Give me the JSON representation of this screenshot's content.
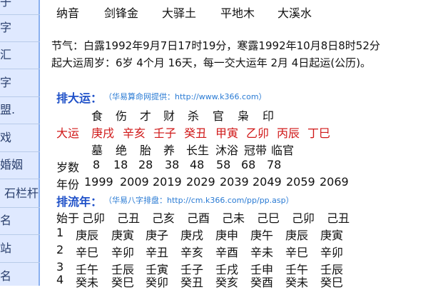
{
  "sidebar": {
    "items": [
      "子",
      "字",
      "汇",
      "字",
      "盟.",
      "戏",
      "婚姻",
      "石栏杆",
      "名",
      "站",
      "名"
    ]
  },
  "nayin": {
    "label": "纳音",
    "values": [
      "剑锋金",
      "大驿土",
      "平地木",
      "大溪水"
    ]
  },
  "jieqi": {
    "line1": "节气：白露1992年9月7日17时19分，寒露1992年10月8日8时52分",
    "line2": "起大运周岁：6岁 4个月 16天，每一交大运年 2月 4日起运(公历)。"
  },
  "dayun": {
    "title": "排大运：",
    "note": "（华易算命网提供：http://www.k366.com）",
    "shishen": [
      "食",
      "伤",
      "才",
      "财",
      "杀",
      "官",
      "枭",
      "印"
    ],
    "label": "大运",
    "ganzhi": [
      "庚戌",
      "辛亥",
      "壬子",
      "癸丑",
      "甲寅",
      "乙卯",
      "丙辰",
      "丁巳"
    ],
    "changsheng": [
      "墓",
      "绝",
      "胎",
      "养",
      "长生",
      "沐浴",
      "冠带",
      "临官"
    ],
    "age_label": "岁数",
    "ages": [
      "8",
      "18",
      "28",
      "38",
      "48",
      "58",
      "68",
      "78"
    ],
    "year_label": "年份",
    "years": [
      "1999",
      "2009",
      "2019",
      "2029",
      "2039",
      "2049",
      "2059",
      "2069"
    ]
  },
  "liunian": {
    "title": "排流年：",
    "note": "（华易八字排盘：http://cm.k366.com/pp/pp.asp）",
    "start_label": "始于",
    "start": [
      "己卯",
      "己丑",
      "己亥",
      "己酉",
      "己未",
      "己巳",
      "己卯",
      "己丑"
    ],
    "rows": [
      {
        "n": "1",
        "vals": [
          "庚辰",
          "庚寅",
          "庚子",
          "庚戌",
          "庚申",
          "庚午",
          "庚辰",
          "庚寅"
        ]
      },
      {
        "n": "2",
        "vals": [
          "辛巳",
          "辛卯",
          "辛丑",
          "辛亥",
          "辛酉",
          "辛未",
          "辛巳",
          "辛卯"
        ]
      },
      {
        "n": "3",
        "vals": [
          "壬午",
          "壬辰",
          "壬寅",
          "壬子",
          "壬戌",
          "壬申",
          "壬午",
          "壬辰"
        ]
      },
      {
        "n": "4",
        "vals": [
          "癸未",
          "癸巳",
          "癸卯",
          "癸丑",
          "癸亥",
          "癸酉",
          "癸未",
          "癸巳"
        ]
      }
    ]
  }
}
